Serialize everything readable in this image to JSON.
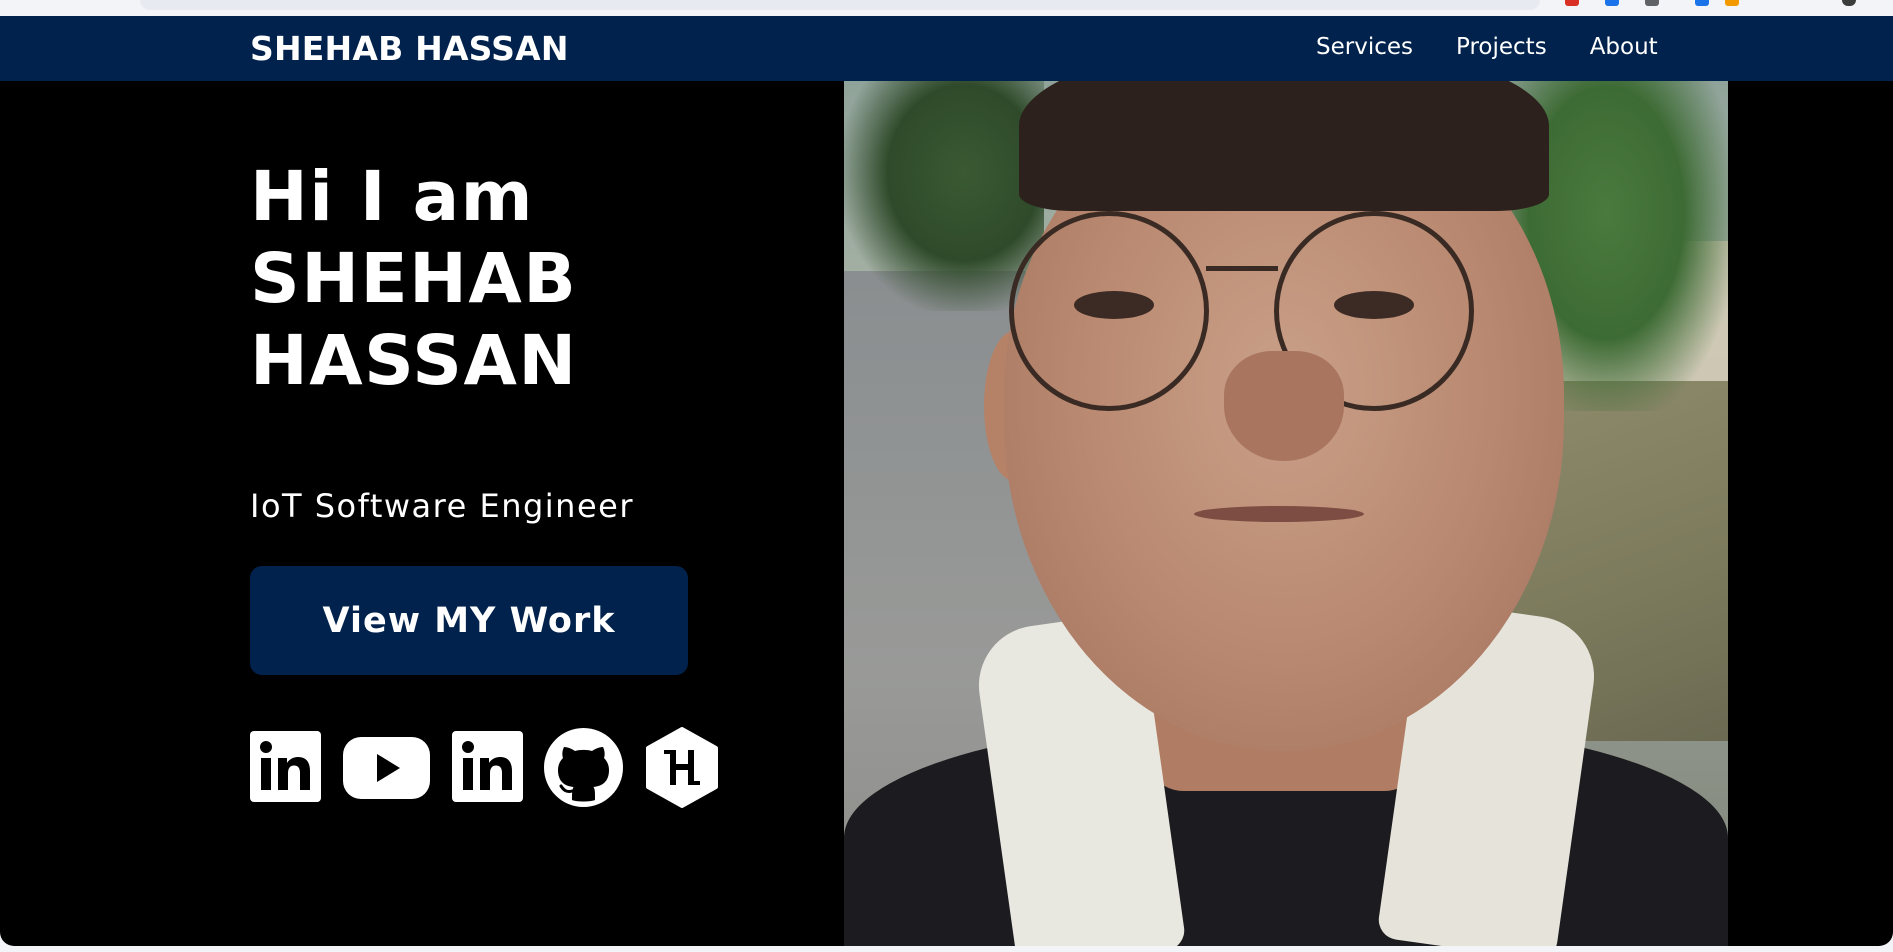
{
  "navbar": {
    "brand": "SHEHAB HASSAN",
    "links": [
      "Services",
      "Projects",
      "About"
    ]
  },
  "hero": {
    "title_lines": [
      "Hi I am",
      "SHEHAB",
      "HASSAN"
    ],
    "subtitle": "IoT Software Engineer",
    "cta_label": "View MY Work"
  },
  "socials": [
    {
      "icon": "linkedin-icon"
    },
    {
      "icon": "youtube-icon"
    },
    {
      "icon": "linkedin-icon"
    },
    {
      "icon": "github-icon"
    },
    {
      "icon": "hashnode-icon"
    }
  ],
  "colors": {
    "navbar_bg": "#00224c",
    "page_bg": "#000000",
    "text": "#ffffff",
    "button_bg": "#00224c"
  }
}
